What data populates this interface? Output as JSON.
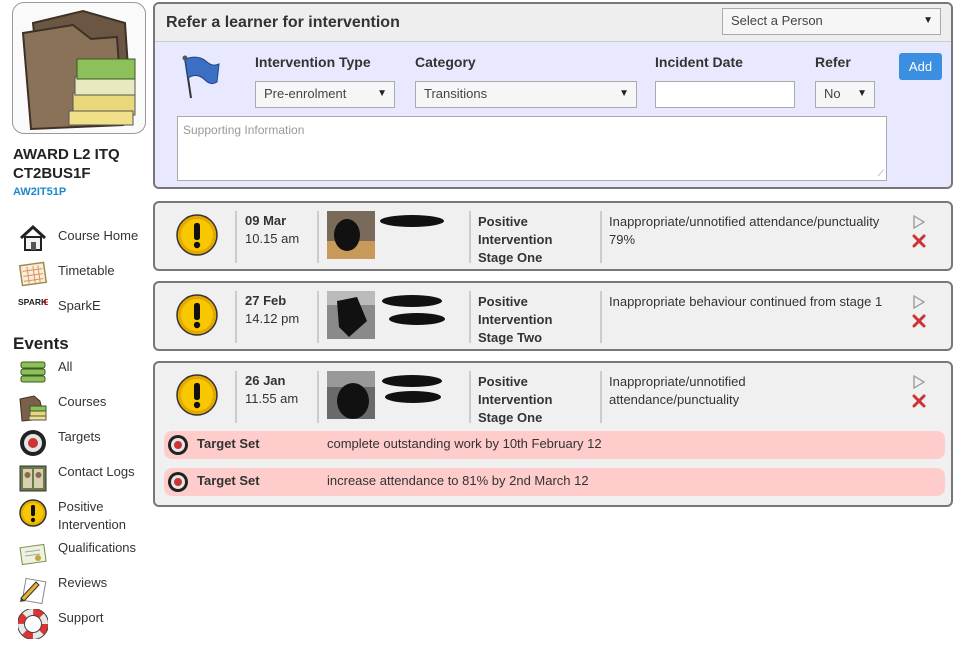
{
  "sidebar": {
    "course_title_line1": "AWARD L2 ITQ",
    "course_title_line2": "CT2BUS1F",
    "course_code": "AW2IT51P",
    "nav": [
      {
        "label": "Course Home",
        "icon": "house-icon"
      },
      {
        "label": "Timetable",
        "icon": "calendar-icon"
      },
      {
        "label": "SparkE",
        "icon": "sparke-logo"
      }
    ],
    "sparke_logo_text": "SPARKE",
    "events_heading": "Events",
    "events": [
      {
        "label": "All",
        "icon": "stack-icon"
      },
      {
        "label": "Courses",
        "icon": "books-icon"
      },
      {
        "label": "Targets",
        "icon": "target-icon"
      },
      {
        "label": "Contact Logs",
        "icon": "contact-log-icon"
      },
      {
        "label": "Positive Intervention",
        "icon": "warning-icon"
      },
      {
        "label": "Qualifications",
        "icon": "certificate-icon"
      },
      {
        "label": "Reviews",
        "icon": "pencil-icon"
      },
      {
        "label": "Support",
        "icon": "lifebuoy-icon"
      }
    ]
  },
  "refer": {
    "title": "Refer a learner for intervention",
    "person_select": "Select a Person",
    "intervention_type_label": "Intervention Type",
    "intervention_type_value": "Pre-enrolment",
    "category_label": "Category",
    "category_value": "Transitions",
    "incident_date_label": "Incident Date",
    "incident_date_value": "",
    "refer_label": "Refer",
    "refer_value": "No",
    "add_label": "Add",
    "supporting_placeholder": "Supporting Information"
  },
  "interventions": [
    {
      "date": "09 Mar",
      "time": "10.15 am",
      "type_line1": "Positive",
      "type_line2": "Intervention",
      "type_line3": "Stage One",
      "description": "Inappropriate/unnotified attendance/punctuality 79%"
    },
    {
      "date": "27 Feb",
      "time": "14.12 pm",
      "type_line1": "Positive",
      "type_line2": "Intervention",
      "type_line3": "Stage Two",
      "description": "Inappropriate behaviour continued from stage 1"
    },
    {
      "date": "26 Jan",
      "time": "11.55 am",
      "type_line1": "Positive",
      "type_line2": "Intervention",
      "type_line3": "Stage One",
      "description": "Inappropriate/unnotified attendance/punctuality",
      "targets": [
        {
          "label": "Target Set",
          "text": "complete outstanding work by 10th February 12"
        },
        {
          "label": "Target Set",
          "text": "increase attendance to 81% by 2nd March 12"
        }
      ]
    }
  ],
  "colors": {
    "accent": "#3b8fe0",
    "course_code": "#1a8acd",
    "refer_panel_bg": "#e8e8ff",
    "target_row_bg": "#ffcccc",
    "delete_red": "#cc3333"
  }
}
